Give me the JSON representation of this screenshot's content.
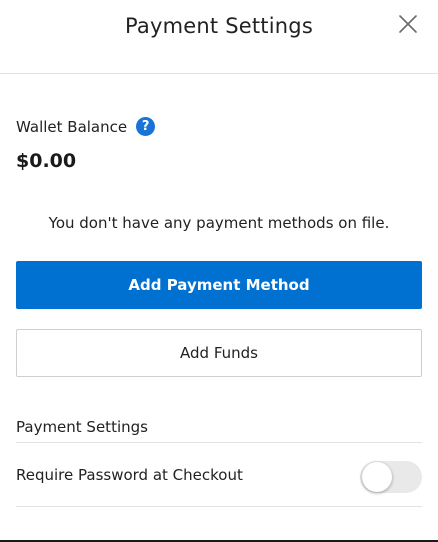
{
  "header": {
    "title": "Payment Settings",
    "close_icon": "close-icon"
  },
  "wallet": {
    "label": "Wallet Balance",
    "help_icon_text": "?",
    "help_icon_color": "#1a73d6",
    "amount": "$0.00"
  },
  "payment_methods": {
    "empty_message": "You don't have any payment methods on file."
  },
  "actions": {
    "add_payment_label": "Add Payment Method",
    "add_payment_color": "#0070d1",
    "add_funds_label": "Add Funds"
  },
  "settings": {
    "section_title": "Payment Settings",
    "require_password_label": "Require Password at Checkout",
    "require_password_enabled": false
  }
}
